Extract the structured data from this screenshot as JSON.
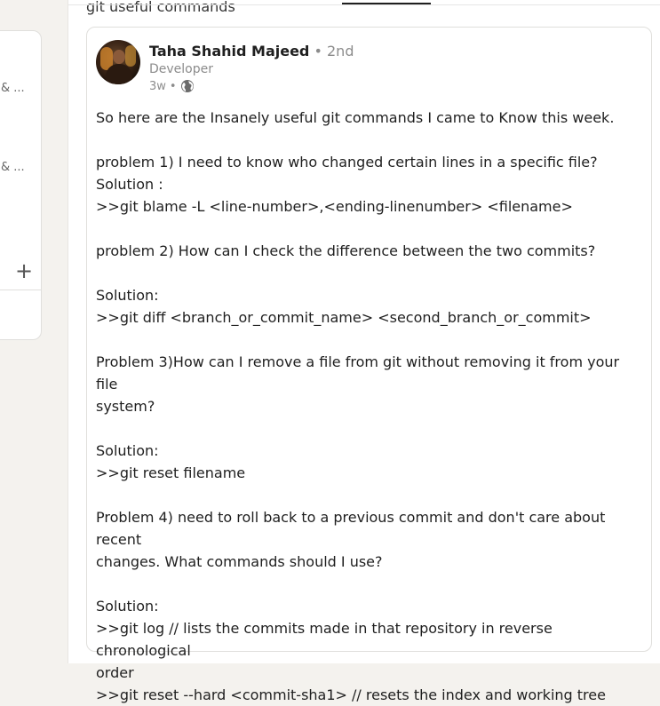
{
  "left_panel": {
    "truncated_items": [
      "& ...",
      "& ..."
    ],
    "add_icon": "plus-icon"
  },
  "feed": {
    "top_title": "git useful commands"
  },
  "post": {
    "author": {
      "name": "Taha Shahid Majeed",
      "separator": "•",
      "degree": "2nd",
      "headline": "Developer",
      "time": "3w",
      "visibility_separator": "•",
      "visibility_icon": "globe-icon"
    },
    "lines": [
      "So here are the Insanely useful git commands I came to Know this week.",
      "",
      "problem 1) I need to know who changed certain lines in a specific file?",
      "Solution :",
      ">>git blame -L <line-number>,<ending-linenumber> <filename>",
      "",
      "problem 2) How can I check the difference between the two commits?",
      "",
      "Solution:",
      ">>git diff <branch_or_commit_name> <second_branch_or_commit>",
      "",
      "Problem 3)How can I remove a file from git without removing it from your file",
      "system?",
      "",
      "Solution:",
      ">>git reset filename",
      "",
      "Problem 4) need to roll back to a previous commit and don't care about recent",
      "changes. What commands should I use?",
      "",
      "Solution:",
      ">>git log // lists the commits made in that repository in reverse chronological",
      "order",
      ">>git reset --hard <commit-sha1> // resets the index and working tree"
    ]
  }
}
